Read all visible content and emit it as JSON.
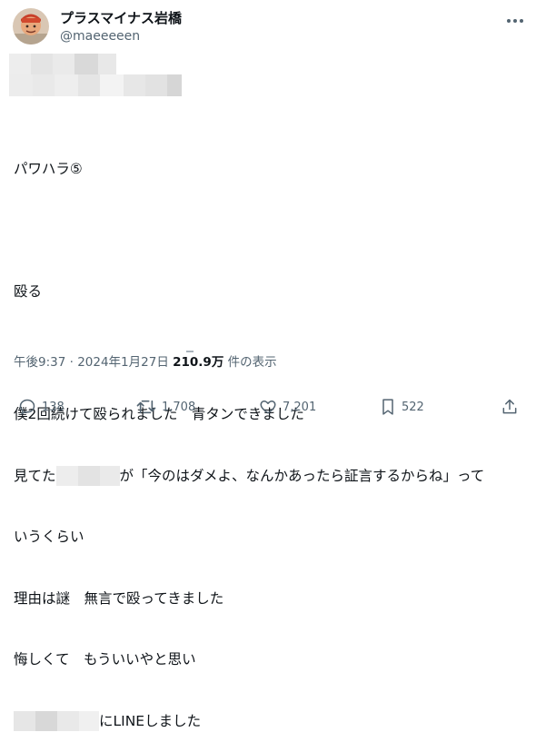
{
  "user": {
    "display_name": "プラスマイナス岩橋",
    "handle": "@maeeeeen"
  },
  "tweet": {
    "lines": [
      "パワハラ⑤",
      "",
      "殴る",
      "",
      "僕2回続けて殴られました　青タンできました",
      "見てた",
      "が「今のはダメよ、なんかあったら証言するからね」って",
      "いうくらい",
      "理由は謎　無言で殴ってきました",
      "悔しくて　もういいやと思い",
      "にLINEしました"
    ]
  },
  "meta": {
    "time": "午後9:37",
    "separator": " · ",
    "date": "2024年1月27日",
    "views_count": "210.9万",
    "views_label": " 件の表示"
  },
  "actions": {
    "replies": "138",
    "retweets": "1,708",
    "likes": "7,201",
    "bookmarks": "522"
  },
  "icons": {
    "more": "more-dots-icon",
    "reply": "reply-icon",
    "retweet": "retweet-icon",
    "like": "heart-icon",
    "bookmark": "bookmark-icon",
    "share": "share-icon"
  },
  "colors": {
    "text": "#0f1419",
    "secondary": "#536471",
    "blur_light": "#ececec",
    "blur_dark": "#d5d5d5"
  }
}
